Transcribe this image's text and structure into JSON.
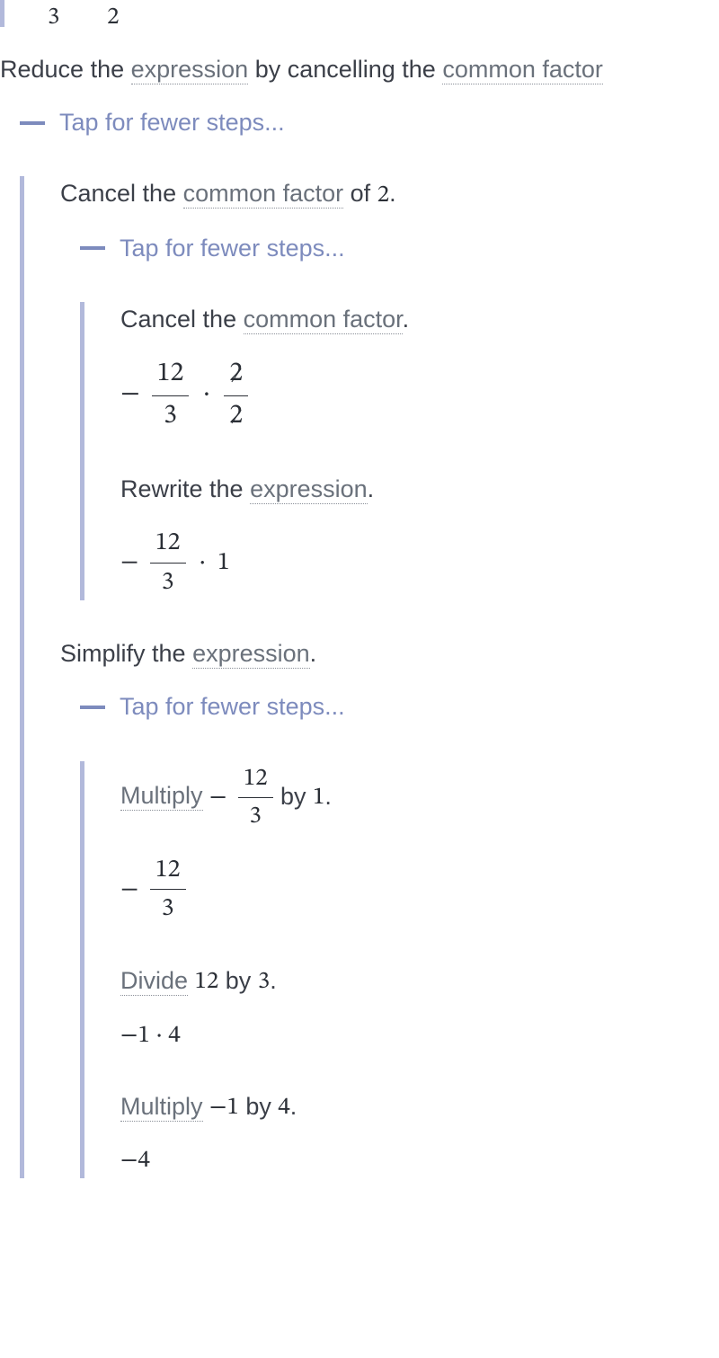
{
  "top_fragment": {
    "d1": "3",
    "d2": "2"
  },
  "s1": {
    "text": {
      "p1": "Reduce the ",
      "g1": "expression",
      "p2": " by cancelling the ",
      "g2": "common factor"
    },
    "tap": "Tap for fewer steps..."
  },
  "s2": {
    "text": {
      "p1": "Cancel the ",
      "g1": "common factor",
      "p2": " of ",
      "m1": "2",
      "p3": "."
    },
    "tap": "Tap for fewer steps..."
  },
  "s2a": {
    "text": {
      "p1": "Cancel the ",
      "g1": "common factor",
      "p2": "."
    },
    "expr": {
      "sign": "−",
      "num1": "12",
      "den1": "3",
      "dot": "⋅",
      "num2": "2",
      "den2": "2"
    }
  },
  "s2b": {
    "text": {
      "p1": "Rewrite the ",
      "g1": "expression",
      "p2": "."
    },
    "expr": {
      "sign": "−",
      "num": "12",
      "den": "3",
      "dot": "⋅",
      "one": "1"
    }
  },
  "s3": {
    "text": {
      "p1": "Simplify the ",
      "g1": "expression",
      "p2": "."
    },
    "tap": "Tap for fewer steps..."
  },
  "s3a": {
    "text": {
      "g1": "Multiply",
      "sp": " ",
      "sign": "−",
      "num": "12",
      "den": "3",
      "p2": " by ",
      "m1": "1",
      "p3": "."
    },
    "expr": {
      "sign": "−",
      "num": "12",
      "den": "3"
    }
  },
  "s3b": {
    "text": {
      "g1": "Divide",
      "sp": " ",
      "m1": "12",
      "p2": " by ",
      "m2": "3",
      "p3": "."
    },
    "expr": {
      "v": "−1 ⋅ 4"
    }
  },
  "s3c": {
    "text": {
      "g1": "Multiply",
      "sp": " ",
      "m1": "−1",
      "p2": " by ",
      "m2": "4",
      "p3": "."
    },
    "expr": {
      "v": "−4"
    }
  }
}
